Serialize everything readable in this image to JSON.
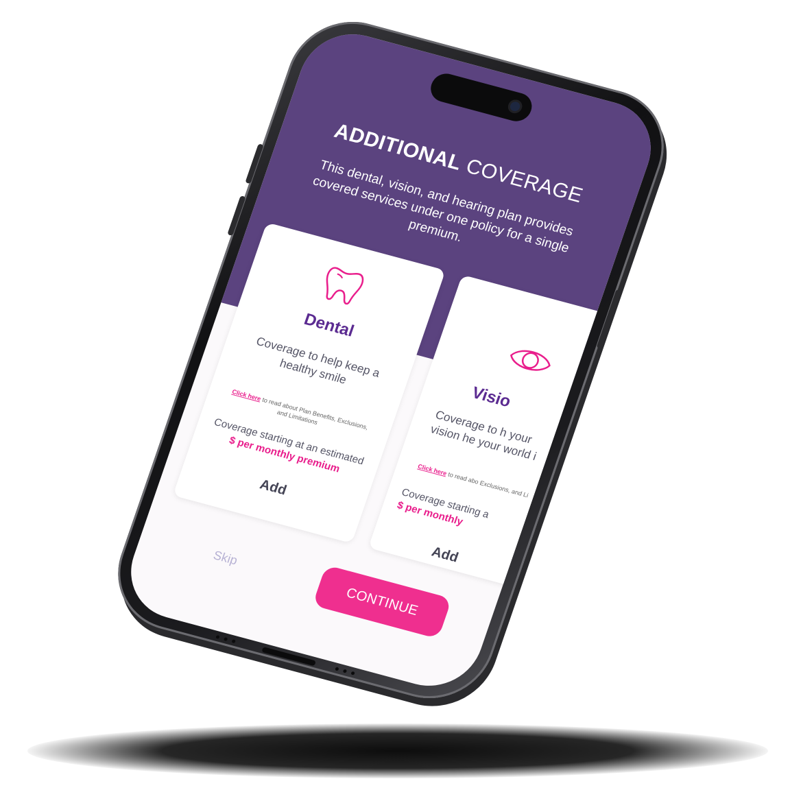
{
  "hero": {
    "title_bold": "ADDITIONAL",
    "title_rest": "COVERAGE",
    "subtitle": "This dental, vision, and hearing plan provides covered services under one policy for a single premium."
  },
  "cards": [
    {
      "icon": "tooth-icon",
      "name": "Dental",
      "description": "Coverage to help keep a healthy smile",
      "link_label": "Click here",
      "link_rest": "to read about Plan Benefits, Exclusions, and Limitations",
      "coverage_label": "Coverage starting at an estimated",
      "price_label": "$ per monthly premium",
      "add_label": "Add"
    },
    {
      "icon": "eye-icon",
      "name": "Visio",
      "description": "Coverage to h your vision he your world i",
      "link_label": "Click here",
      "link_rest": "to read abo Exclusions, and Li",
      "coverage_label": "Coverage starting a",
      "price_label": "$ per monthly",
      "add_label": "Add"
    }
  ],
  "actions": {
    "skip_label": "Skip",
    "continue_label": "CONTINUE"
  },
  "colors": {
    "hero_bg": "#5b437f",
    "accent": "#ef2f8f",
    "card_title": "#5b2b91"
  }
}
